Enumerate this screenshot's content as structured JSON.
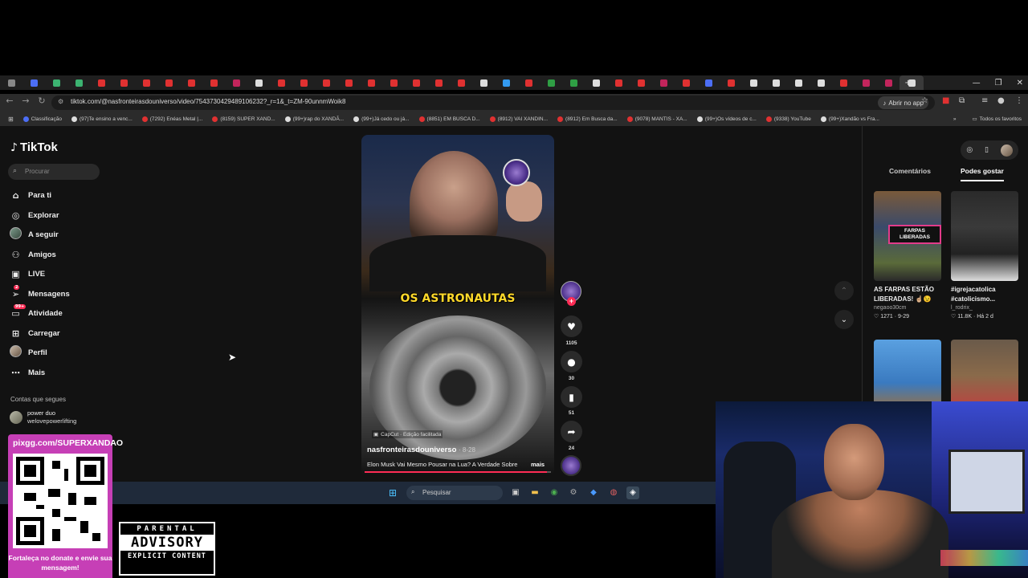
{
  "browser": {
    "url": "tiktok.com/@nasfronteirasdouniverso/video/7543730429489106232?_r=1&_t=ZM-90unnmWoik8",
    "open_app_label": "Abrir no app",
    "bookmarks": [
      {
        "label": "Classificação",
        "color": "#4c6ef5"
      },
      {
        "label": "(97)Te ensino a venc...",
        "color": "#ddd"
      },
      {
        "label": "(7292) Enéas Metal |...",
        "color": "#e03131"
      },
      {
        "label": "(8159) SUPER XAND...",
        "color": "#e03131"
      },
      {
        "label": "(99+)rap do XANDÃ...",
        "color": "#ddd"
      },
      {
        "label": "(99+)Já cedo ou já...",
        "color": "#ddd"
      },
      {
        "label": "(8851) EM BUSCA D...",
        "color": "#e03131"
      },
      {
        "label": "(8912) VAI XANDIN...",
        "color": "#e03131"
      },
      {
        "label": "(8912) Em Busca da...",
        "color": "#e03131"
      },
      {
        "label": "(9078) MANTIS - XA...",
        "color": "#e03131"
      },
      {
        "label": "(99+)Os vídeos de c...",
        "color": "#ddd"
      },
      {
        "label": "(9338) YouTube",
        "color": "#e03131"
      },
      {
        "label": "(99+)Xandão vs Fra...",
        "color": "#ddd"
      }
    ],
    "all_bookmarks_label": "Todos os favoritos"
  },
  "sidebar": {
    "logo": "TikTok",
    "search_placeholder": "Procurar",
    "nav": [
      {
        "label": "Para ti",
        "icon": "home-icon"
      },
      {
        "label": "Explorar",
        "icon": "compass-icon"
      },
      {
        "label": "A seguir",
        "icon": "following-avatar"
      },
      {
        "label": "Amigos",
        "icon": "friends-icon"
      },
      {
        "label": "LIVE",
        "icon": "live-icon"
      },
      {
        "label": "Mensagens",
        "icon": "messages-icon",
        "badge": "2"
      },
      {
        "label": "Atividade",
        "icon": "activity-icon",
        "badge": "99+"
      },
      {
        "label": "Carregar",
        "icon": "upload-icon"
      },
      {
        "label": "Perfil",
        "icon": "profile-avatar"
      },
      {
        "label": "Mais",
        "icon": "more-icon"
      }
    ],
    "following_title": "Contas que segues",
    "following": [
      {
        "name": "power duo",
        "handle": "welovepowerlifting"
      }
    ]
  },
  "video": {
    "overlay_text": "OS ASTRONAUTAS",
    "capcut_label": "CapCut · Edição facilitada",
    "author": "nasfronteirasdouniverso",
    "date": "· 8-28",
    "description": "Elon Musk Vai Mesmo Pousar na Lua? A Verdade Sobre",
    "more_label": "mais",
    "progress": 0.98,
    "likes": "1105",
    "comments": "30",
    "saves": "51",
    "shares": "24"
  },
  "right_panel": {
    "tabs": [
      "Comentários",
      "Podes gostar"
    ],
    "active_tab": 1,
    "cards": [
      {
        "title": "AS FARPAS ESTÃO LIBERADAS! ☝🏼😉",
        "user": "negaoo30cm",
        "stats": "♡ 1271 · 9-29",
        "thumb_text": "FARPAS LIBERADAS"
      },
      {
        "title": "#igrejacatolica #catolicismo...",
        "user": "l_rodrix_",
        "stats": "♡ 11.8K · Há 2 d"
      }
    ]
  },
  "taskbar": {
    "search_placeholder": "Pesquisar"
  },
  "overlay": {
    "qr_url": "pixgg.com/SUPERXANDAO",
    "qr_message": "Fortaleça no donate e envie sua mensagem!",
    "advisory_top": "PARENTAL",
    "advisory_mid": "ADVISORY",
    "advisory_bot": "EXPLICIT CONTENT"
  }
}
